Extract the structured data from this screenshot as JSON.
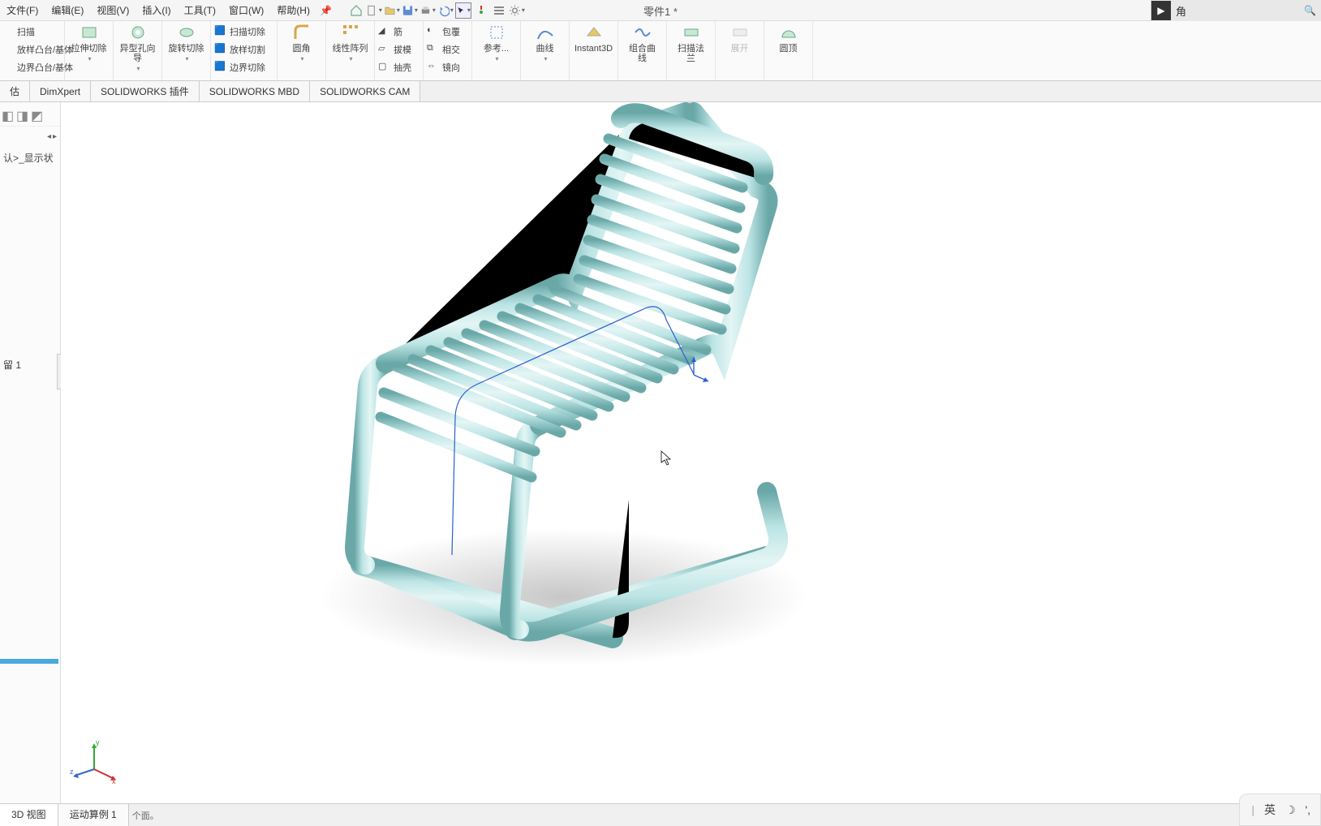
{
  "top_menu": {
    "file": "文件(F)",
    "edit": "编辑(E)",
    "view": "视图(V)",
    "insert": "插入(I)",
    "tools": "工具(T)",
    "window": "窗口(W)",
    "help": "帮助(H)"
  },
  "doc_title": "零件1 *",
  "search_hint": "角",
  "ribbon": {
    "scan": "扫描",
    "loft": "放样凸台/基体",
    "boundary": "边界凸台/基体",
    "extcut": "拉伸切除",
    "hole": "异型孔向导",
    "revcut": "旋转切除",
    "scancut": "扫描切除",
    "loftcut": "放样切割",
    "boundcut": "边界切除",
    "fillet": "圆角",
    "pattern": "线性阵列",
    "rib": "筋",
    "draft": "拔模",
    "shell": "抽壳",
    "wrap": "包覆",
    "intersect": "相交",
    "mirror": "镜向",
    "refgeo": "参考...",
    "curves": "曲线",
    "instant3d": "Instant3D",
    "combcurve_a": "组合曲",
    "combcurve_b": "线",
    "sweepflange_a": "扫描法",
    "sweepflange_b": "兰",
    "unfold": "展开",
    "dome": "圆顶"
  },
  "tabs": {
    "evaluate": "估",
    "dimxpert": "DimXpert",
    "addins": "SOLIDWORKS 插件",
    "mbd": "SOLIDWORKS MBD",
    "cam": "SOLIDWORKS CAM"
  },
  "left_panel": {
    "display_state": "认>_显示状",
    "node": "留 1"
  },
  "triad": {
    "x": "x",
    "y": "y",
    "z": "z"
  },
  "bottom": {
    "view3d": "3D 视图",
    "motion": "运动算例 1",
    "caption": "个面。"
  },
  "ime": {
    "lang": "英"
  }
}
